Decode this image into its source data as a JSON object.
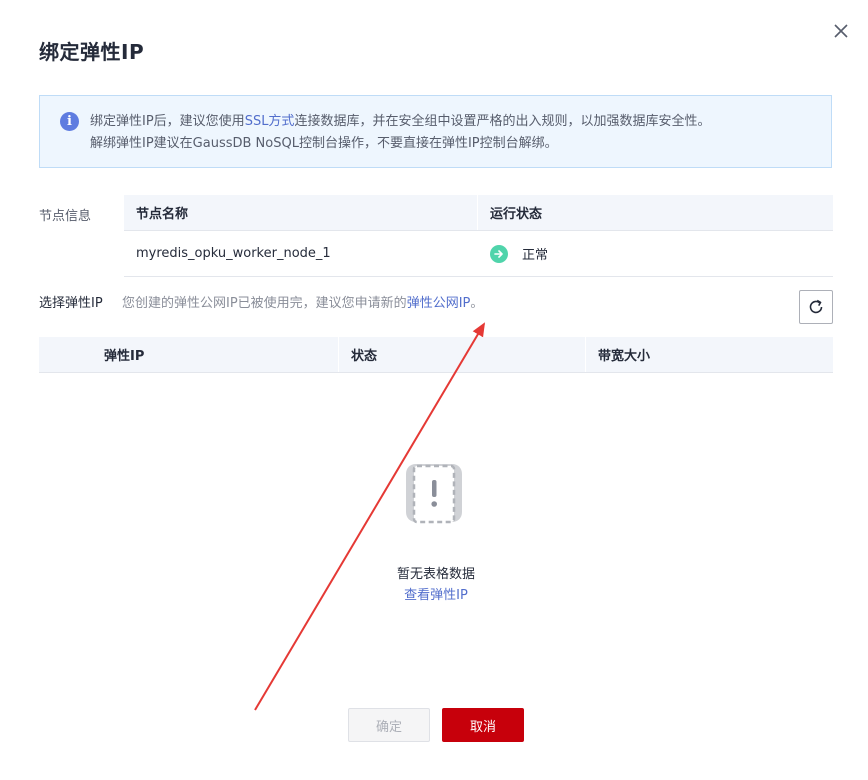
{
  "dialog": {
    "title": "绑定弹性IP",
    "close_icon": "close-icon"
  },
  "notice": {
    "icon": "info-icon",
    "line1_prefix": "绑定弹性IP后，建议您使用",
    "line1_link": "SSL方式",
    "line1_suffix": "连接数据库，并在安全组中设置严格的出入规则，以加强数据库安全性。",
    "line2": "解绑弹性IP建议在GaussDB NoSQL控制台操作，不要直接在弹性IP控制台解绑。"
  },
  "node_info": {
    "label": "节点信息",
    "headers": [
      "节点名称",
      "运行状态"
    ],
    "rows": [
      {
        "name": "myredis_opku_worker_node_1",
        "status": "正常",
        "status_icon": "arrow-right-circle-icon",
        "status_color": "#50d4ab"
      }
    ]
  },
  "select_eip": {
    "label": "选择弹性IP",
    "hint_prefix": "您创建的弹性公网IP已被使用完，建议您申请新的",
    "hint_link": "弹性公网IP",
    "hint_suffix": "。",
    "refresh_icon": "refresh-icon"
  },
  "eip_table": {
    "headers": [
      "弹性IP",
      "状态",
      "带宽大小"
    ],
    "empty_icon": "empty-warning-icon",
    "empty_text": "暂无表格数据",
    "empty_link": "查看弹性IP"
  },
  "footer": {
    "ok_label": "确定",
    "cancel_label": "取消"
  },
  "colors": {
    "primary_red": "#c7000b",
    "link_blue": "#526ecc",
    "annotation_arrow": "#e53935"
  }
}
